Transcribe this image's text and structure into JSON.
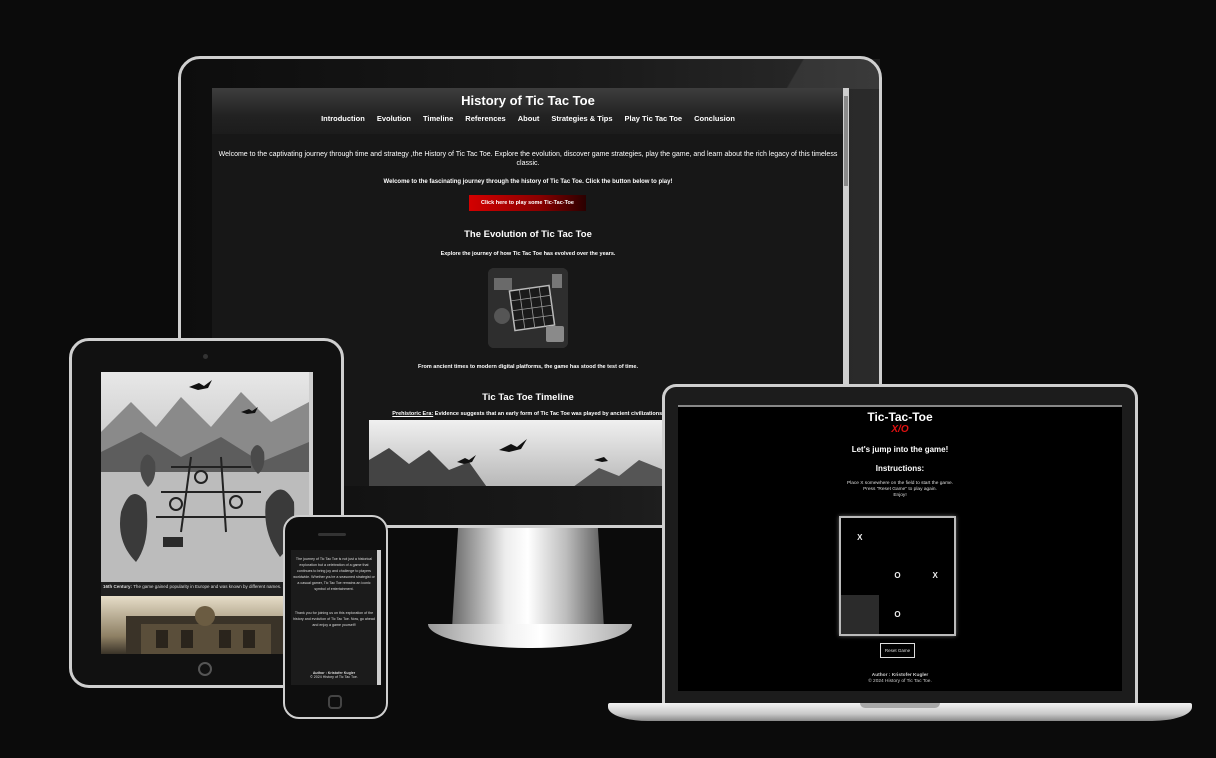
{
  "desktop": {
    "site_title": "History of Tic Tac Toe",
    "nav": [
      "Introduction",
      "Evolution",
      "Timeline",
      "References",
      "About",
      "Strategies & Tips",
      "Play Tic Tac Toe",
      "Conclusion"
    ],
    "welcome_text": "Welcome to the captivating journey through time and strategy ,the History of Tic Tac Toe. Explore the evolution, discover game strategies, play the game, and learn about the rich legacy of this timeless classic.",
    "welcome_text2": "Welcome to the fascinating journey through the history of Tic Tac Toe. Click the button below to play!",
    "play_button": "Click here to play some Tic-Tac-Toe",
    "evolution_title": "The Evolution of Tic Tac Toe",
    "evolution_subtitle": "Explore the journey of how Tic Tac Toe has evolved over the years.",
    "evolution_caption": "From ancient times to modern digital platforms, the game has stood the test of time.",
    "timeline_title": "Tic Tac Toe Timeline",
    "timeline_item_label": "Prehistoric Era:",
    "timeline_item_text": "Evidence suggests that an early form of Tic Tac Toe was played by ancient civilizations."
  },
  "tablet": {
    "caption_label": "16th Century:",
    "caption_text": "The game gained popularity in Europe and was known by different names."
  },
  "phone": {
    "paragraph1": "The journey of Tic Tac Toe is not just a historical exploration but a celebration of a game that continues to bring joy and challenge to players worldwide. Whether you're a seasoned strategist or a casual gamer, Tic Tac Toe remains an iconic symbol of entertainment.",
    "paragraph2": "Thank you for joining us on this exploration of the history and evolution of Tic Tac Toe. Now, go ahead and enjoy a game yourself!",
    "footer_author": "Author : Kristofer Kugler",
    "footer_copy": "© 2024 History of Tic Tac Toe."
  },
  "laptop": {
    "title": "Tic-Tac-Toe",
    "subtitle": "X/O",
    "heading": "Let's jump into the game!",
    "instructions_title": "Instructions:",
    "instructions_line1": "Place X somewhere on the field to start the game.",
    "instructions_line2": "Press \"Reset Game\" to play again.",
    "instructions_line3": "Enjoy!",
    "board": [
      "X",
      "",
      "",
      "",
      "O",
      "X",
      "",
      "O",
      ""
    ],
    "reset_button": "Reset Game",
    "footer_author": "Author : Kristofer Kugler",
    "footer_copy": "© 2024 History of Tic Tac Toe."
  },
  "colors": {
    "background": "#0b0b0b",
    "accent_red": "#d40000",
    "device_frame": "#cfcfcf"
  }
}
